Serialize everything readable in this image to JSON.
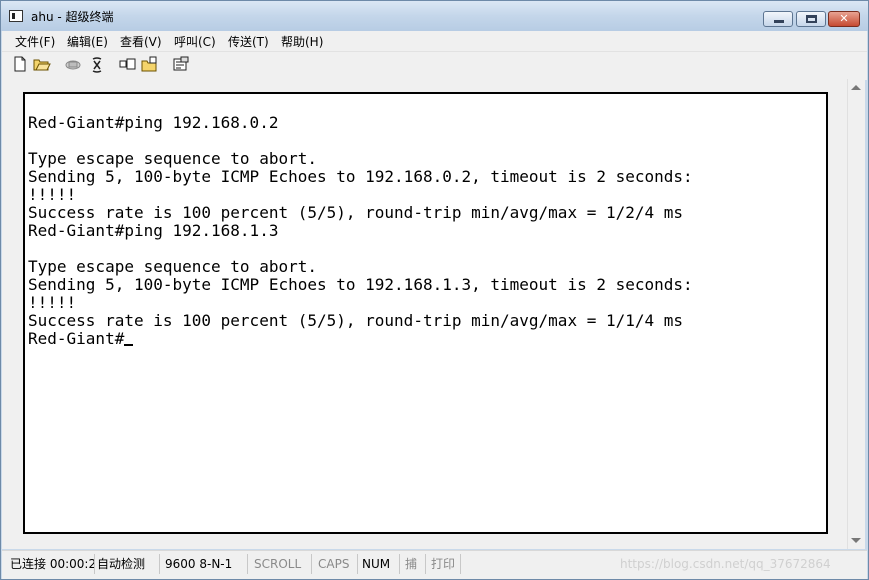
{
  "window": {
    "title": "ahu - 超级终端"
  },
  "menu": [
    "文件(F)",
    "编辑(E)",
    "查看(V)",
    "呼叫(C)",
    "传送(T)",
    "帮助(H)"
  ],
  "toolbar": {
    "icons": [
      "new-file-icon",
      "open-folder-icon",
      "phone-call-icon",
      "disconnect-icon",
      "send-icon",
      "receive-icon",
      "properties-icon"
    ]
  },
  "terminal": {
    "lines": [
      "",
      "Red-Giant#ping 192.168.0.2",
      "",
      "Type escape sequence to abort.",
      "Sending 5, 100-byte ICMP Echoes to 192.168.0.2, timeout is 2 seconds:",
      "!!!!!",
      "Success rate is 100 percent (5/5), round-trip min/avg/max = 1/2/4 ms",
      "Red-Giant#ping 192.168.1.3",
      "",
      "Type escape sequence to abort.",
      "Sending 5, 100-byte ICMP Echoes to 192.168.1.3, timeout is 2 seconds:",
      "!!!!!",
      "Success rate is 100 percent (5/5), round-trip min/avg/max = 1/1/4 ms",
      "Red-Giant#"
    ]
  },
  "status": {
    "connected": "已连接 00:00:2",
    "detect": "自动检测",
    "port": "9600 8-N-1",
    "scroll": "SCROLL",
    "caps": "CAPS",
    "num": "NUM",
    "capture": "捕",
    "print": "打印",
    "watermark": "https://blog.csdn.net/qq_37672864"
  }
}
